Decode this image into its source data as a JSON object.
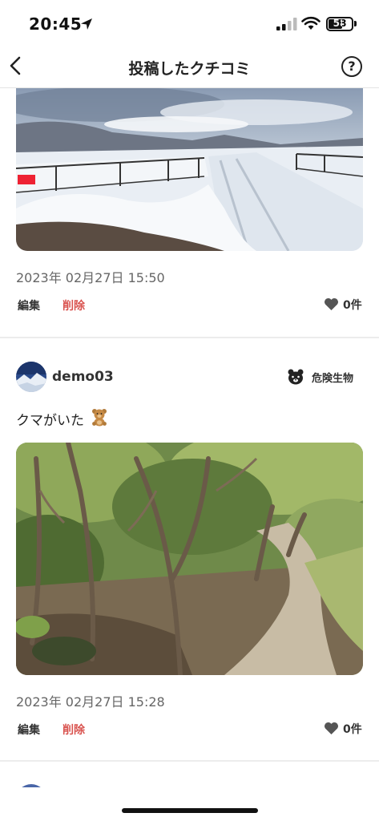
{
  "status_bar": {
    "time": "20:45",
    "battery": "58",
    "icons": [
      "location-arrow-icon",
      "cellular-signal-icon",
      "wifi-icon",
      "battery-icon"
    ]
  },
  "nav": {
    "title": "投稿したクチコミ",
    "back_icon": "chevron-left-icon",
    "help_label": "?"
  },
  "posts": [
    {
      "photo": "snowy-road-photo",
      "date": "2023年 02月27日 15:50",
      "edit_label": "編集",
      "delete_label": "削除",
      "like_count": "0件"
    },
    {
      "username": "demo03",
      "category_label": "危険生物",
      "category_icon": "bear-icon",
      "comment": "クマがいた",
      "comment_emoji": "teddy-bear-emoji",
      "photo": "forest-trail-photo",
      "date": "2023年 02月27日 15:28",
      "edit_label": "編集",
      "delete_label": "削除",
      "like_count": "0件"
    }
  ],
  "colors": {
    "delete": "#d9534f",
    "divider": "#ececec",
    "text": "#222222"
  }
}
